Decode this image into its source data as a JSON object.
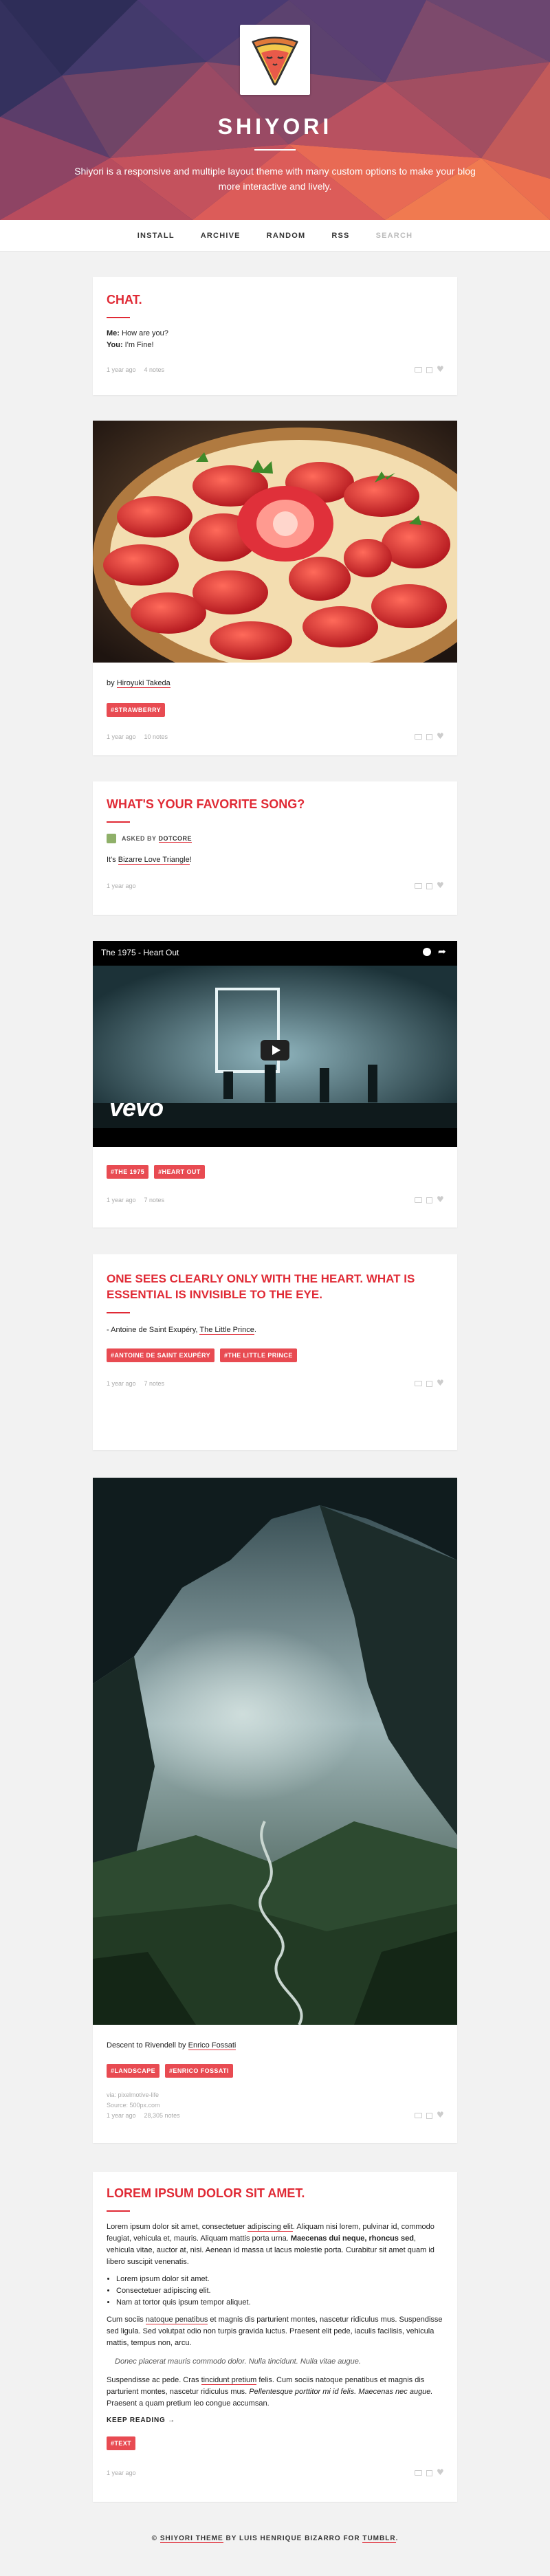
{
  "site": {
    "title": "SHIYORI",
    "description": "Shiyori is a responsive and multiple layout theme with many custom options to make your blog more interactive and lively."
  },
  "nav": [
    "INSTALL",
    "ARCHIVE",
    "RANDOM",
    "RSS",
    "SEARCH"
  ],
  "chat": {
    "title": "CHAT.",
    "line1_name": "Me:",
    "line1_text": " How are you?",
    "line2_name": "You:",
    "line2_text": " I'm Fine!",
    "time": "1 year ago",
    "notes": "4 notes"
  },
  "photo": {
    "caption_prefix": "by ",
    "caption_link": "Hiroyuki Takeda",
    "tag": "#STRAWBERRY",
    "time": "1 year ago",
    "notes": "10 notes"
  },
  "ask": {
    "title": "WHAT'S YOUR FAVORITE SONG?",
    "asked_by": "ASKED BY",
    "asker": "DOTCORE",
    "answer_prefix": "It's ",
    "answer_link": "Bizarre Love Triangle",
    "answer_suffix": "!",
    "time": "1 year ago"
  },
  "video": {
    "player_title": "The 1975 - Heart Out",
    "brand": "vevo",
    "tags": [
      "#THE 1975",
      "#HEART OUT"
    ],
    "time": "1 year ago",
    "notes": "7 notes"
  },
  "quote": {
    "title": "ONE SEES CLEARLY ONLY WITH THE HEART. WHAT IS ESSENTIAL IS INVISIBLE TO THE EYE.",
    "source_prefix": "- Antoine de Saint Exupéry, ",
    "source_link": "The Little Prince",
    "source_suffix": ".",
    "tags": [
      "#ANTOINE DE SAINT EXUPÉRY",
      "#THE LITTLE PRINCE"
    ],
    "time": "1 year ago",
    "notes": "7 notes"
  },
  "landscape": {
    "caption_prefix": "Descent to Rivendell by ",
    "caption_link": "Enrico Fossati",
    "tags": [
      "#LANDSCAPE",
      "#ENRICO FOSSATI"
    ],
    "via": "via: pixelmotive-life",
    "source": "Source: 500px.com",
    "time": "1 year ago",
    "notes": "28,305 notes"
  },
  "text": {
    "title": "LOREM IPSUM DOLOR SIT AMET.",
    "p1_a": "Lorem ipsum dolor sit amet, consectetuer ",
    "p1_link": "adipiscing elit",
    "p1_b": ". Aliquam nisi lorem, pulvinar id, commodo feugiat, vehicula et, mauris. Aliquam mattis porta urna. ",
    "p1_bold": "Maecenas dui neque, rhoncus sed",
    "p1_c": ", vehicula vitae, auctor at, nisi. Aenean id massa ut lacus molestie porta. Curabitur sit amet quam id libero suscipit venenatis.",
    "bullets": [
      "Lorem ipsum dolor sit amet.",
      "Consectetuer adipiscing elit.",
      "Nam at tortor quis ipsum tempor aliquet."
    ],
    "p2_a": "Cum sociis ",
    "p2_link": "natoque penatibus",
    "p2_b": " et magnis dis parturient montes, nascetur ridiculus mus. Suspendisse sed ligula. Sed volutpat odio non turpis gravida luctus. Praesent elit pede, iaculis facilisis, vehicula mattis, tempus non, arcu.",
    "blockquote": "Donec placerat mauris commodo dolor. Nulla tincidunt. Nulla vitae augue.",
    "p3_a": "Suspendisse ac pede. Cras ",
    "p3_link": "tincidunt pretium",
    "p3_b": " felis. Cum sociis natoque penatibus et magnis dis parturient montes, nascetur ridiculus mus. ",
    "p3_italic": "Pellentesque porttitor mi id felis. Maecenas nec augue.",
    "p3_c": " Praesent a quam pretium leo congue accumsan.",
    "keep_reading": "KEEP READING →",
    "tag": "#TEXT",
    "time": "1 year ago"
  },
  "footer": {
    "copy": "© ",
    "theme": "SHIYORI THEME",
    "by": " BY ",
    "author": "LUIS HENRIQUE BIZARRO",
    "for": " FOR ",
    "platform": "TUMBLR",
    "end": "."
  }
}
